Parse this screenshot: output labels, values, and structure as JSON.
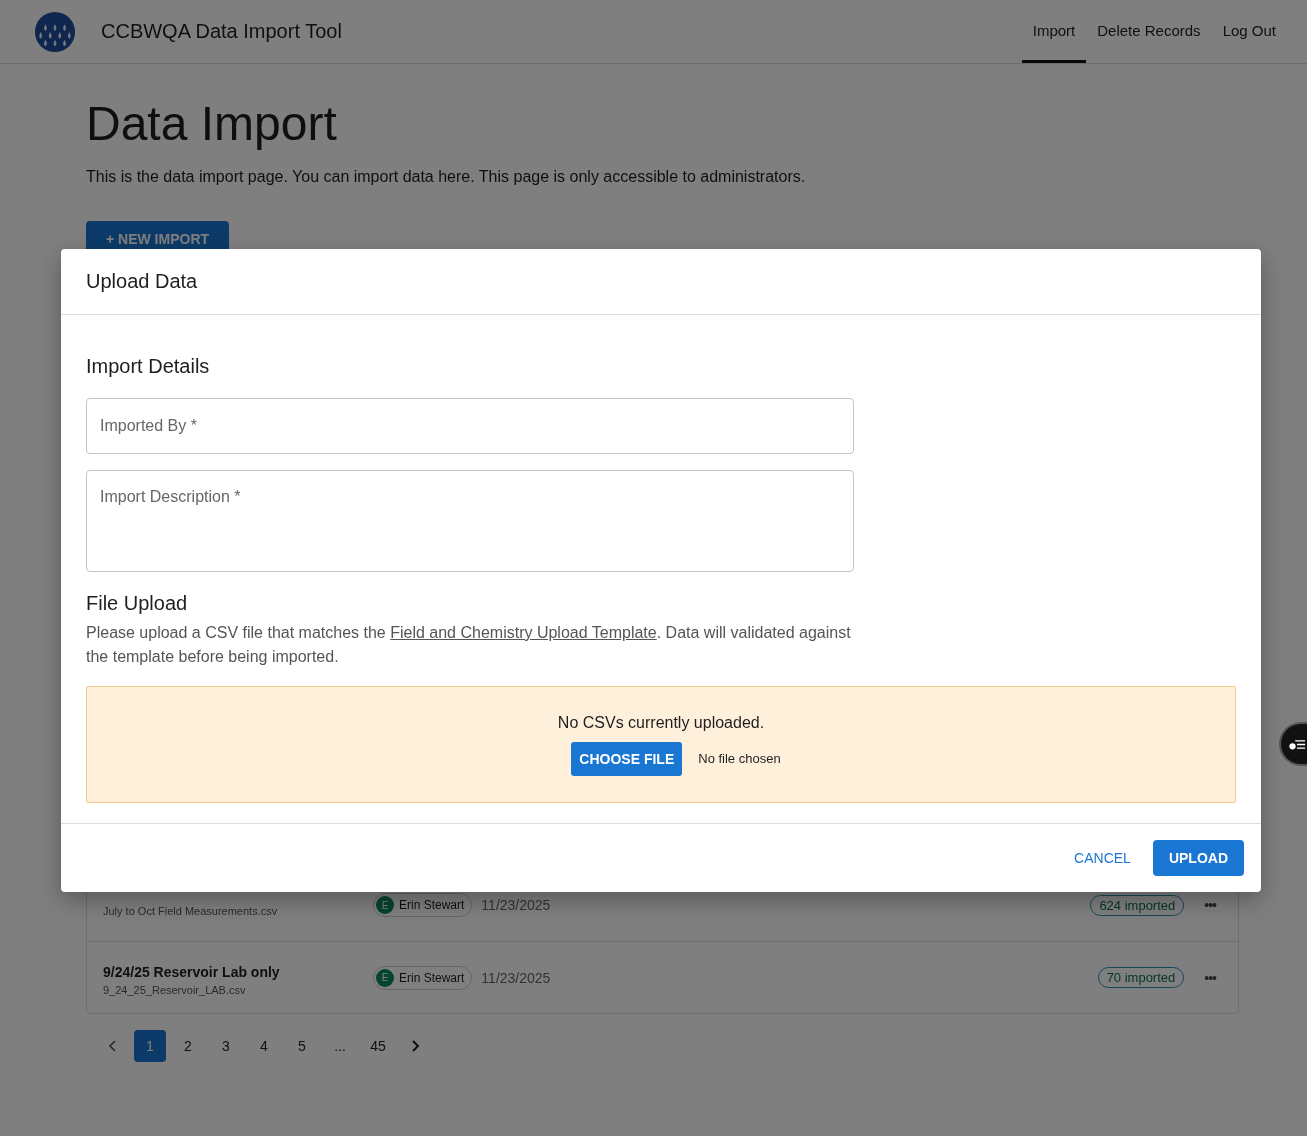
{
  "app": {
    "title": "CCBWQA Data Import Tool"
  },
  "nav": [
    {
      "label": "Import",
      "selected": true
    },
    {
      "label": "Delete Records",
      "selected": false
    },
    {
      "label": "Log Out",
      "selected": false
    }
  ],
  "page": {
    "heading": "Data Import",
    "intro": "This is the data import page. You can import data here. This page is only accessible to administrators.",
    "new_button": "+ NEW IMPORT"
  },
  "imports": [
    {
      "file": "July to Oct Field Measurements.csv",
      "user_initial": "E",
      "user": "Erin Stewart",
      "date": "11/23/2025",
      "status": "624 imported",
      "menu": "•••"
    },
    {
      "title": "9/24/25 Reservoir Lab only",
      "file": "9_24_25_Reservoir_LAB.csv",
      "user_initial": "E",
      "user": "Erin Stewart",
      "date": "11/23/2025",
      "status": "70 imported",
      "menu": "•••"
    }
  ],
  "pagination": [
    {
      "label": "1",
      "selected": true
    },
    {
      "label": "2",
      "selected": false
    },
    {
      "label": "3",
      "selected": false
    },
    {
      "label": "4",
      "selected": false
    },
    {
      "label": "5",
      "selected": false
    },
    {
      "label": "...",
      "selected": false
    },
    {
      "label": "45",
      "selected": false
    }
  ],
  "dialog": {
    "title": "Upload Data",
    "details_heading": "Import Details",
    "fields": [
      {
        "placeholder": "Imported By *",
        "kind": "input"
      },
      {
        "placeholder": "Import Description *",
        "kind": "textarea"
      }
    ],
    "upload_heading": "File Upload",
    "upload_text_before": "Please upload a CSV file that matches the ",
    "upload_link": "Field and Chemistry Upload Template",
    "upload_text_after": ". Data will validated against the template before being imported.",
    "dropzone_message": "No CSVs currently uploaded.",
    "choose_button": "CHOOSE FILE",
    "file_status": "No file chosen",
    "cancel": "CANCEL",
    "upload": "UPLOAD"
  }
}
